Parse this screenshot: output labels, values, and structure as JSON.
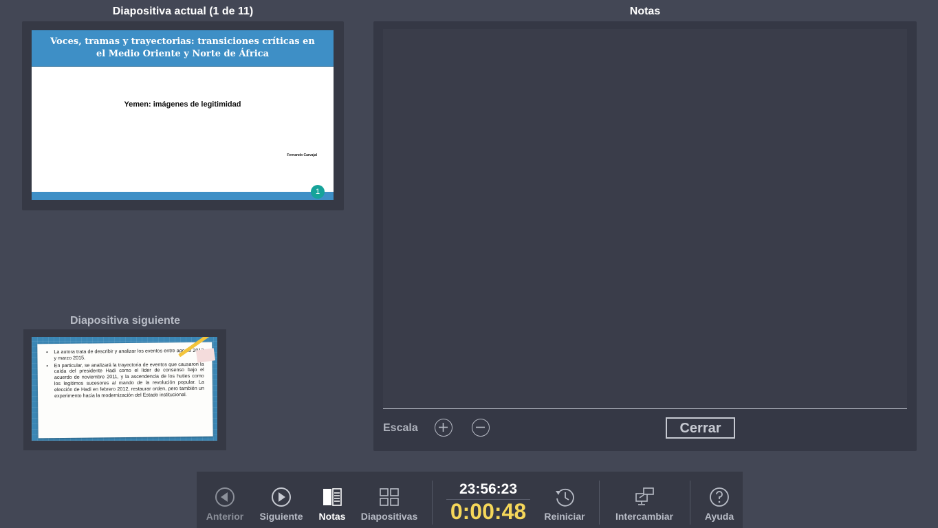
{
  "headers": {
    "current": "Diapositiva actual (1 de 11)",
    "notes": "Notas",
    "next": "Diapositiva siguiente"
  },
  "current_slide": {
    "title": "Voces, tramas y trayectorias: transiciones críticas en el Medio Oriente y Norte de África",
    "subtitle": "Yemen: imágenes de legitimidad",
    "author": "Fernando Carvajal",
    "page_number": "1",
    "accent_color": "#3e8fc6"
  },
  "next_slide": {
    "bullets": [
      "La autora trata de describir y analizar los eventos entre agosto 2013 y marzo 2015.",
      "En particular, se analizará la trayectoria de eventos que causaron la caída del presidente Hadi como el líder de consenso bajo el acuerdo de noviembre 2011, y la ascendencia de los huties como los legítimos sucesores al mando de la revolución popular. La elección de Hadi en febrero 2012, restaurar orden, pero también un experimento hacia la modernización del Estado institucional."
    ]
  },
  "notes_panel": {
    "scale_label": "Escala",
    "zoom_in_icon": "plus-circle-icon",
    "zoom_out_icon": "minus-circle-icon",
    "close_label": "Cerrar"
  },
  "toolbar": {
    "prev": "Anterior",
    "next": "Siguiente",
    "notes": "Notas",
    "slides": "Diapositivas",
    "clock": "23:56:23",
    "timer": "0:00:48",
    "restart": "Reiniciar",
    "switch": "Intercambiar",
    "help": "Ayuda"
  },
  "colors": {
    "background": "#434755",
    "timer": "#f5d75a",
    "active_tool": "#ffffff",
    "inactive_tool": "#b8bcc6"
  }
}
